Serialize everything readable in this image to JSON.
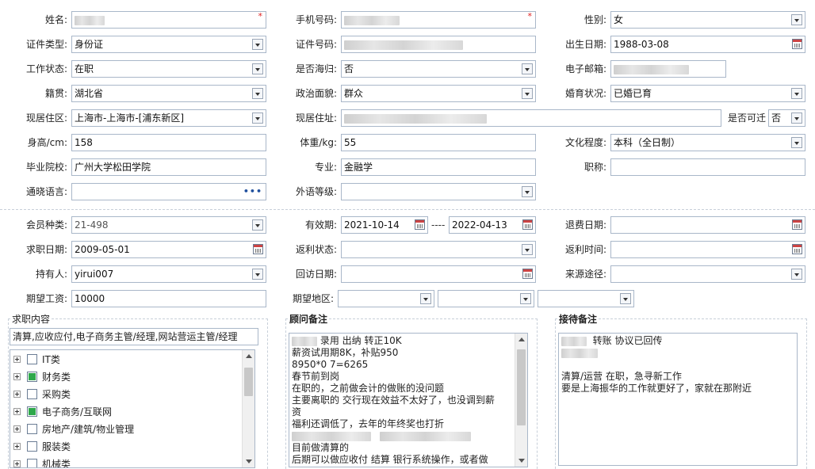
{
  "profile": {
    "name_label": "姓名:",
    "phone_label": "手机号码:",
    "gender_label": "性别:",
    "gender_value": "女",
    "id_type_label": "证件类型:",
    "id_type_value": "身份证",
    "id_number_label": "证件号码:",
    "birthdate_label": "出生日期:",
    "birthdate_value": "1988-03-08",
    "work_status_label": "工作状态:",
    "work_status_value": "在职",
    "returnee_label": "是否海归:",
    "returnee_value": "否",
    "email_label": "电子邮箱:",
    "native_label": "籍贯:",
    "native_value": "湖北省",
    "political_label": "政治面貌:",
    "political_value": "群众",
    "marital_label": "婚育状况:",
    "marital_value": "已婚已育",
    "residence_area_label": "现居住区:",
    "residence_area_value": "上海市-上海市-[浦东新区]",
    "residence_addr_label": "现居住址:",
    "relocate_label": "是否可迁",
    "relocate_value": "否",
    "height_label": "身高/cm:",
    "height_value": "158",
    "weight_label": "体重/kg:",
    "weight_value": "55",
    "education_label": "文化程度:",
    "education_value": "本科（全日制）",
    "school_label": "毕业院校:",
    "school_value": "广州大学松田学院",
    "major_label": "专业:",
    "major_value": "金融学",
    "title_label": "职称:",
    "language_label": "通晓语言:",
    "language_more": "•••",
    "foreign_level_label": "外语等级:"
  },
  "membership": {
    "member_type_label": "会员种类:",
    "member_type_value": "21-498",
    "validity_label": "有效期:",
    "valid_from": "2021-10-14",
    "valid_sep": "----",
    "valid_to": "2022-04-13",
    "refund_date_label": "退费日期:",
    "apply_date_label": "求职日期:",
    "apply_date_value": "2009-05-01",
    "rebate_status_label": "返利状态:",
    "rebate_time_label": "返利时间:",
    "holder_label": "持有人:",
    "holder_value": "yirui007",
    "visit_date_label": "回访日期:",
    "source_label": "来源途径:",
    "salary_label": "期望工资:",
    "salary_value": "10000",
    "region_label": "期望地区:"
  },
  "job_content": {
    "title": "求职内容",
    "summary": "清算,应收应付,电子商务主管/经理,网站营运主管/经理",
    "categories": [
      {
        "label": "IT类",
        "checked": false
      },
      {
        "label": "财务类",
        "checked": true
      },
      {
        "label": "采购类",
        "checked": false
      },
      {
        "label": "电子商务/互联网",
        "checked": true
      },
      {
        "label": "房地产/建筑/物业管理",
        "checked": false
      },
      {
        "label": "服装类",
        "checked": false
      },
      {
        "label": "机械类",
        "checked": false
      }
    ]
  },
  "advisor_notes": {
    "title": "顾问备注",
    "line1": "录用 出纳 转正10K",
    "line2": "薪资试用期8K，补贴950",
    "line3": "8950*0 7=6265",
    "line4": "春节前到岗",
    "line5": "在职的，之前做会计的做账的没问题",
    "line6": "主要离职的  交行现在效益不太好了，也没调到薪",
    "line7": "资",
    "line8": "福利还调低了，去年的年终奖也打折",
    "line10": "目前做清算的",
    "line11": "后期可以做应收付  结算  银行系统操作，或者做"
  },
  "reception_notes": {
    "title": "接待备注",
    "line1": "转账  协议已回传",
    "line3": "清算/运营  在职，急寻新工作",
    "line4": "要是上海振华的工作就更好了，家就在那附近"
  }
}
